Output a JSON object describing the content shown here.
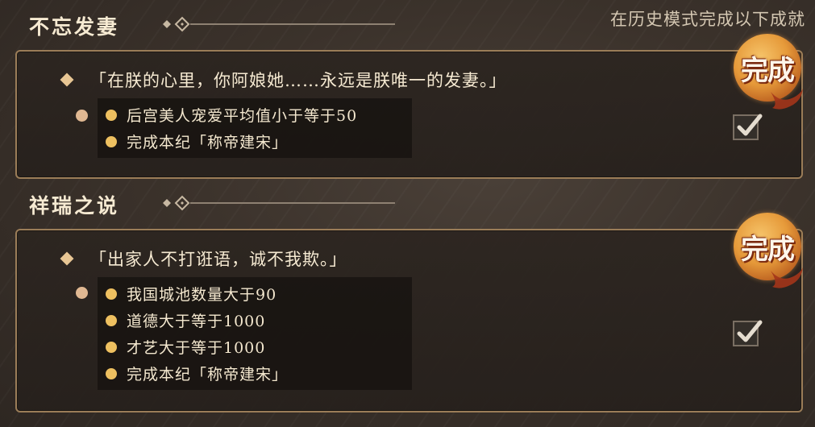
{
  "header": {
    "hint": "在历史模式完成以下成就"
  },
  "achievements": [
    {
      "title": "不忘发妻",
      "quote": "「在朕的心里，你阿娘她……永远是朕唯一的发妻。」",
      "conditions": [
        "后宫美人宠爱平均值小于等于50",
        "完成本纪「称帝建宋」"
      ],
      "status": "完成",
      "checked": true
    },
    {
      "title": "祥瑞之说",
      "quote": "「出家人不打诳语，诚不我欺。」",
      "conditions": [
        "我国城池数量大于90",
        "道德大于等于1000",
        "才艺大于等于1000",
        "完成本纪「称帝建宋」"
      ],
      "status": "完成",
      "checked": true
    }
  ],
  "colors": {
    "accent_gold": "#eec060",
    "border": "#9b7d58",
    "seal_orange": "#e69a3a"
  }
}
